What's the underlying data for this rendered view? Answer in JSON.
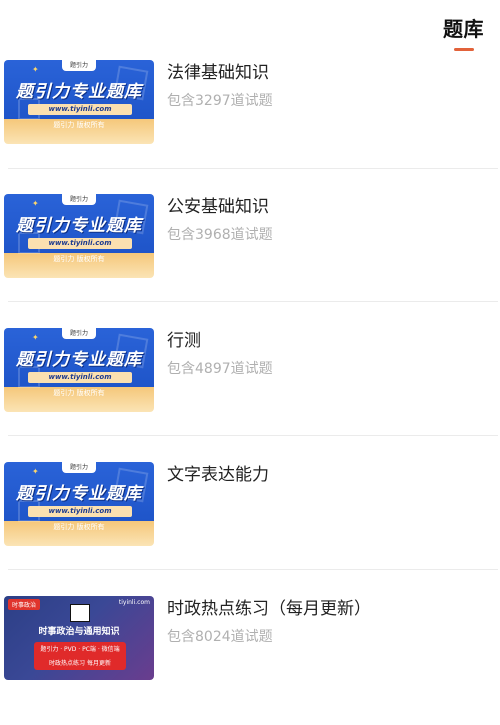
{
  "header": {
    "tab_label": "题库"
  },
  "thumb": {
    "brand": "题引力",
    "title": "题引力专业题库",
    "url": "www.tiyinli.com",
    "sub": "题引力 版权所有"
  },
  "dark_thumb": {
    "tag": "时事政治",
    "site": "tiyinli.com",
    "title": "时事政治与通用知识",
    "banner_line1": "题引力 · PVD · PC端 · 微信端",
    "banner_line2": "时政热点练习 每月更新"
  },
  "items": [
    {
      "title": "法律基础知识",
      "count": "包含3297道试题"
    },
    {
      "title": "公安基础知识",
      "count": "包含3968道试题"
    },
    {
      "title": "行测",
      "count": "包含4897道试题"
    },
    {
      "title": "文字表达能力",
      "count": ""
    },
    {
      "title": "时政热点练习（每月更新）",
      "count": "包含8024道试题"
    }
  ]
}
